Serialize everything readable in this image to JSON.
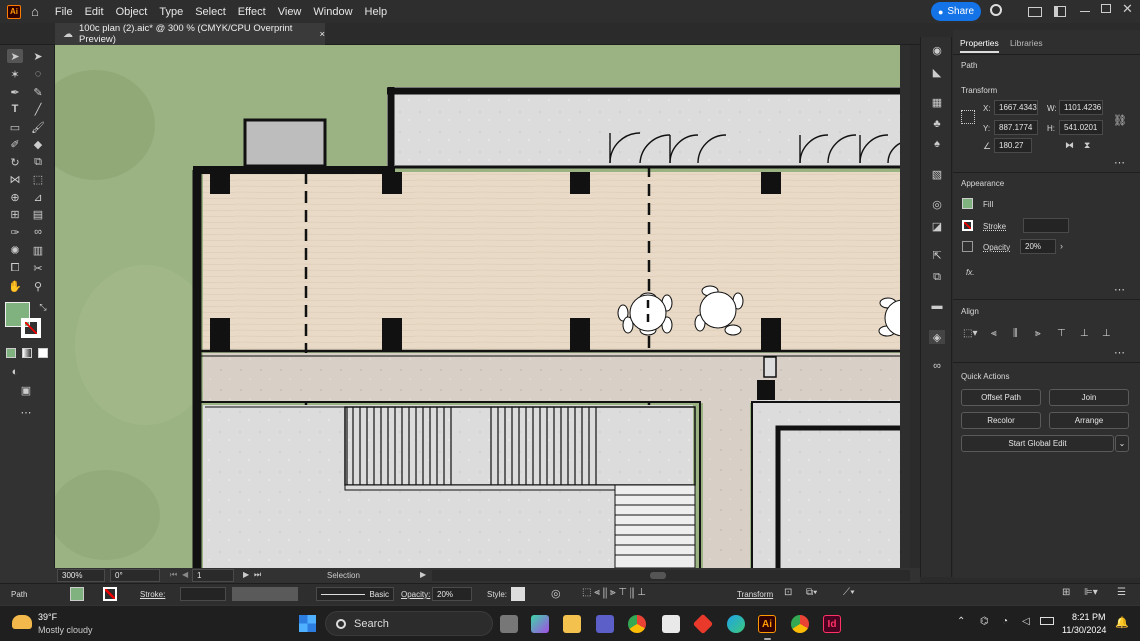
{
  "menu": {
    "app_logo": "Ai",
    "items": [
      "File",
      "Edit",
      "Object",
      "Type",
      "Select",
      "Effect",
      "View",
      "Window",
      "Help"
    ],
    "share_label": "Share"
  },
  "document_tab": {
    "title": "100c plan (2).aic* @ 300 % (CMYK/CPU Overprint Preview)",
    "close": "×"
  },
  "properties": {
    "tabs": [
      "Properties",
      "Libraries"
    ],
    "selection_type": "Path",
    "transform": {
      "heading": "Transform",
      "x_label": "X:",
      "x": "1667.4343",
      "y_label": "Y:",
      "y": "887.1774",
      "w_label": "W:",
      "w": "1101.4236",
      "h_label": "H:",
      "h": "541.0201",
      "angle": "180.27"
    },
    "appearance": {
      "heading": "Appearance",
      "fill_label": "Fill",
      "stroke_label": "Stroke",
      "opacity_label": "Opacity",
      "opacity_value": "20%",
      "fx_label": "fx."
    },
    "align": {
      "heading": "Align"
    },
    "quick_actions": {
      "heading": "Quick Actions",
      "buttons": [
        "Offset Path",
        "Join",
        "Recolor",
        "Arrange"
      ],
      "global_edit": "Start Global Edit"
    }
  },
  "status_bar": {
    "zoom": "300%",
    "rotation": "0°",
    "artboard": "1",
    "tool": "Selection"
  },
  "control_bar": {
    "object_type": "Path",
    "stroke_label": "Stroke:",
    "brush": "Basic",
    "opacity_label": "Opacity:",
    "opacity_value": "20%",
    "style_label": "Style:",
    "transform_label": "Transform"
  },
  "taskbar": {
    "weather_temp": "39°F",
    "weather_desc": "Mostly cloudy",
    "search_placeholder": "Search",
    "time": "8:21 PM",
    "date": "11/30/2024"
  },
  "colors": {
    "accent": "#1473e6",
    "fill_swatch": "#7fb27f",
    "grass": "#8aa66c",
    "wood_floor": "#e8d9c5",
    "concrete": "#d9d9d9",
    "wall": "#111111",
    "ai_orange": "#ff9a00"
  }
}
